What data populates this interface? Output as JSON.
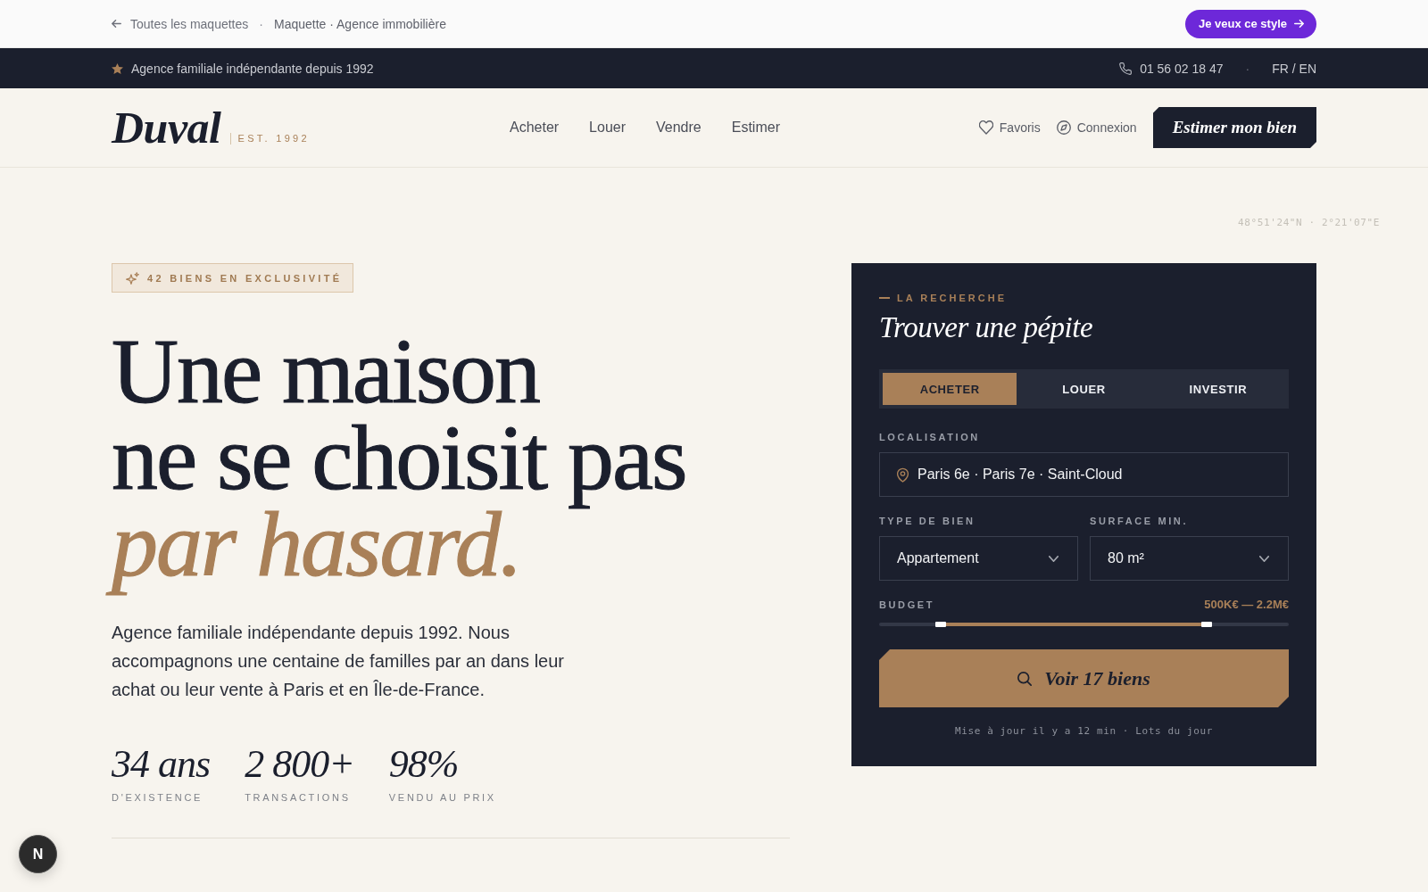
{
  "top_bar": {
    "back_link": "Toutes les maquettes",
    "separator": "·",
    "breadcrumb": "Maquette · Agence immobilière",
    "cta_button": "Je veux ce style"
  },
  "info_bar": {
    "tagline": "Agence familiale indépendante depuis 1992",
    "phone": "01 56 02 18 47",
    "separator": "·",
    "languages": "FR / EN"
  },
  "header": {
    "logo": "Duval",
    "logo_tagline": "EST. 1992",
    "nav": [
      {
        "label": "Acheter"
      },
      {
        "label": "Louer"
      },
      {
        "label": "Vendre"
      },
      {
        "label": "Estimer"
      }
    ],
    "actions": [
      {
        "kind": "favorites",
        "label": "Favoris"
      },
      {
        "kind": "login",
        "label": "Connexion"
      }
    ],
    "cta_button": "Estimer mon bien"
  },
  "coordinates": "48°51'24\"N · 2°21'07\"E",
  "hero": {
    "badge": "42 BIENS EN EXCLUSIVITÉ",
    "headline": [
      {
        "text": "Une maison",
        "kind": "plain"
      },
      {
        "text": "ne se choisit pas",
        "kind": "plain"
      },
      {
        "text": "par hasard.",
        "kind": "accent"
      }
    ],
    "intro": "Agence familiale indépendante depuis 1992. Nous accompagnons une centaine de familles par an dans leur achat ou leur vente à Paris et en Île-de-France.",
    "stats": [
      {
        "value": "34 ans",
        "label": "D'EXISTENCE"
      },
      {
        "value": "2 800+",
        "label": "TRANSACTIONS"
      },
      {
        "value": "98%",
        "label": "VENDU AU PRIX"
      }
    ]
  },
  "search_card": {
    "eyebrow": "LA RECHERCHE",
    "title": "Trouver une pépite",
    "tabs": [
      {
        "label": "ACHETER",
        "selected": true
      },
      {
        "label": "LOUER",
        "selected": false
      },
      {
        "label": "INVESTIR",
        "selected": false
      }
    ],
    "location": {
      "label": "LOCALISATION",
      "value": "Paris 6e · Paris 7e · Saint-Cloud"
    },
    "selects": [
      {
        "label": "TYPE DE BIEN",
        "value": "Appartement"
      },
      {
        "label": "SURFACE MIN.",
        "value": "80 m²"
      }
    ],
    "budget": {
      "label": "BUDGET",
      "range": "500K€ — 2.2M€",
      "handles": [
        {
          "level": 0.15
        },
        {
          "level": 0.8
        }
      ]
    },
    "submit_button": "Voir 17 biens",
    "footnote": "Mise à jour il y a 12 min · Lots du jour"
  },
  "dev_badge": "N"
}
